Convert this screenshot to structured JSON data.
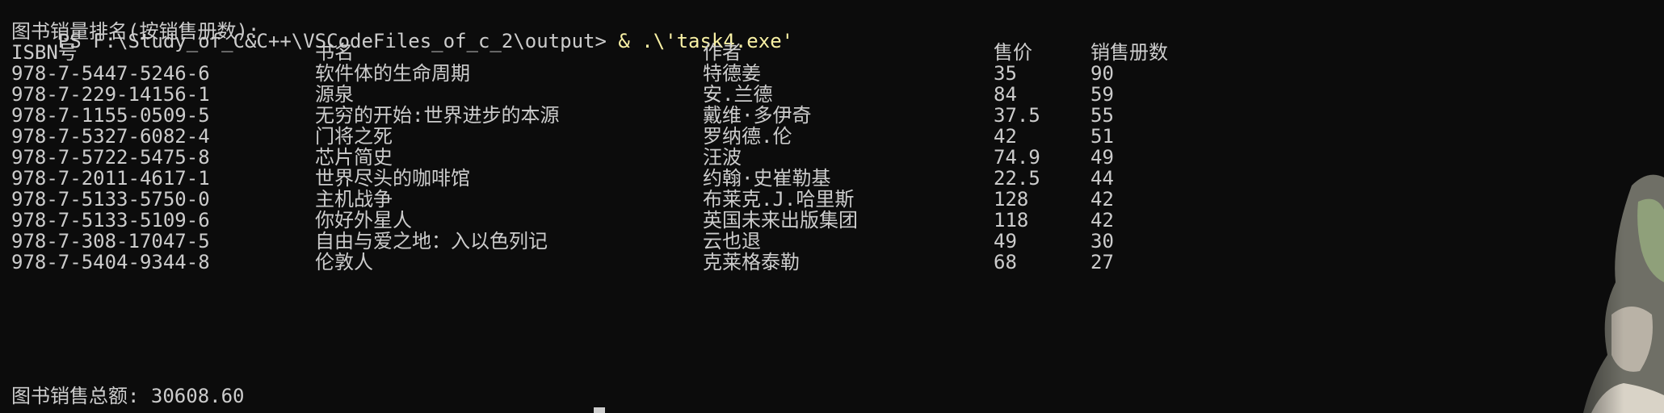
{
  "prompt": {
    "path": "PS F:\\Study_of_C&C++\\VSCodeFiles_of_c_2\\output> ",
    "command": "& .\\'task4.exe'"
  },
  "ranking_title": "图书销量排名(按销售册数):",
  "headers": {
    "isbn": "ISBN号",
    "title": "书名",
    "author": "作者",
    "price": "售价",
    "sales": "销售册数"
  },
  "rows": [
    {
      "isbn": "978-7-5447-5246-6",
      "title": "软件体的生命周期",
      "author": "特德姜",
      "price": "35",
      "sales": "90"
    },
    {
      "isbn": "978-7-229-14156-1",
      "title": "源泉",
      "author": "安.兰德",
      "price": "84",
      "sales": "59"
    },
    {
      "isbn": "978-7-1155-0509-5",
      "title": "无穷的开始:世界进步的本源",
      "author": "戴维·多伊奇",
      "price": "37.5",
      "sales": "55"
    },
    {
      "isbn": "978-7-5327-6082-4",
      "title": "门将之死",
      "author": "罗纳德.伦",
      "price": "42",
      "sales": "51"
    },
    {
      "isbn": "978-7-5722-5475-8",
      "title": "芯片简史",
      "author": "汪波",
      "price": "74.9",
      "sales": "49"
    },
    {
      "isbn": "978-7-2011-4617-1",
      "title": "世界尽头的咖啡馆",
      "author": "约翰·史崔勒基",
      "price": "22.5",
      "sales": "44"
    },
    {
      "isbn": "978-7-5133-5750-0",
      "title": "主机战争",
      "author": "布莱克.J.哈里斯",
      "price": "128",
      "sales": "42"
    },
    {
      "isbn": "978-7-5133-5109-6",
      "title": "你好外星人",
      "author": "英国未来出版集团",
      "price": "118",
      "sales": "42"
    },
    {
      "isbn": "978-7-308-17047-5",
      "title": "自由与爱之地：入以色列记",
      "author": "云也退",
      "price": "49",
      "sales": "30"
    },
    {
      "isbn": "978-7-5404-9344-8",
      "title": "伦敦人",
      "author": "克莱格泰勒",
      "price": "68",
      "sales": "27"
    }
  ],
  "total_line": "图书销售总额: 30608.60",
  "colors": {
    "background": "#0c0c0c",
    "text": "#cccccc",
    "command": "#f9f1a5"
  }
}
